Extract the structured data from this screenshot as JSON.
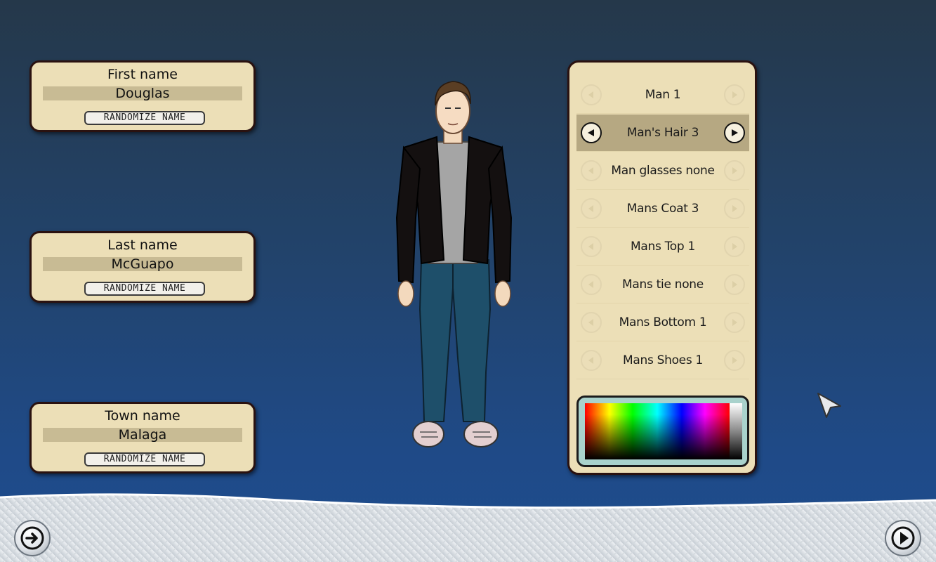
{
  "name_cards": [
    {
      "label": "First name",
      "value": "Douglas",
      "button": "RANDOMIZE NAME"
    },
    {
      "label": "Last name",
      "value": "McGuapo",
      "button": "RANDOMIZE NAME"
    },
    {
      "label": "Town name",
      "value": "Malaga",
      "button": "RANDOMIZE NAME"
    }
  ],
  "options": [
    {
      "label": "Man 1",
      "selected": false
    },
    {
      "label": "Man's Hair 3",
      "selected": true
    },
    {
      "label": "Man glasses none",
      "selected": false
    },
    {
      "label": "Mans Coat 3",
      "selected": false
    },
    {
      "label": "Mans Top 1",
      "selected": false
    },
    {
      "label": "Mans tie none",
      "selected": false
    },
    {
      "label": "Mans Bottom 1",
      "selected": false
    },
    {
      "label": "Mans Shoes 1",
      "selected": false
    }
  ],
  "icons": {
    "exit": "exit-arrow-icon",
    "next": "play-next-icon",
    "prev_option": "arrow-left-icon",
    "next_option": "arrow-right-icon"
  },
  "colors": {
    "card_bg": "#ecdfb7",
    "card_border": "#2a1210",
    "selected_row": "#b6a882",
    "color_picker_frame": "#a9d2cc"
  }
}
